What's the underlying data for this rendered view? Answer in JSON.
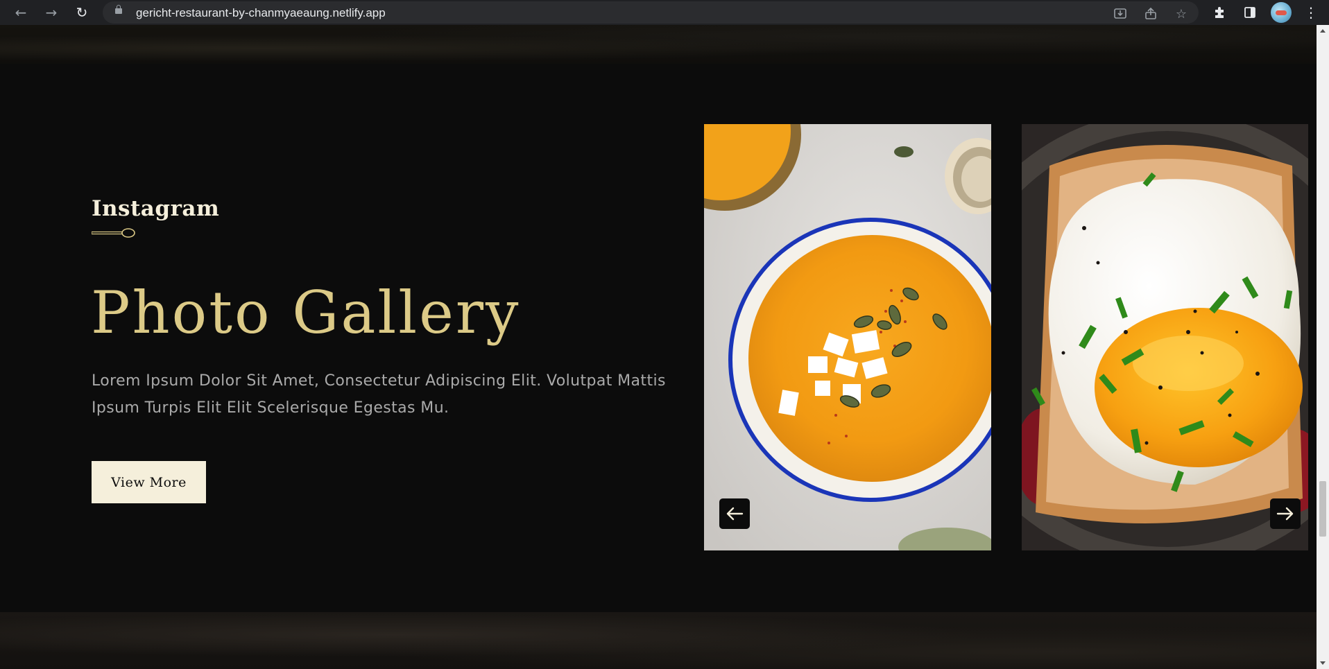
{
  "browser": {
    "url": "gericht-restaurant-by-chanmyaeaung.netlify.app",
    "icons": [
      "back-icon",
      "forward-icon",
      "reload-icon",
      "lock-icon",
      "install-icon",
      "share-icon",
      "bookmark-star-icon",
      "extensions-icon",
      "side-panel-icon",
      "profile-avatar",
      "menu-kebab-icon"
    ]
  },
  "gallery": {
    "subtitle": "Instagram",
    "title": "Photo Gallery",
    "description": "Lorem Ipsum Dolor Sit Amet, Consectetur Adipiscing Elit. Volutpat Mattis Ipsum Turpis Elit Elit Scelerisque Egestas Mu.",
    "button_label": "View More",
    "images": [
      "pumpkin-soup-photo",
      "fried-egg-toast-photo"
    ],
    "controls": [
      "arrow-left-icon",
      "arrow-right-icon"
    ]
  },
  "colors": {
    "background": "#0c0c0c",
    "golden": "#dcca87",
    "cream": "#f5efdb",
    "text_grey": "#aaaaaa"
  }
}
